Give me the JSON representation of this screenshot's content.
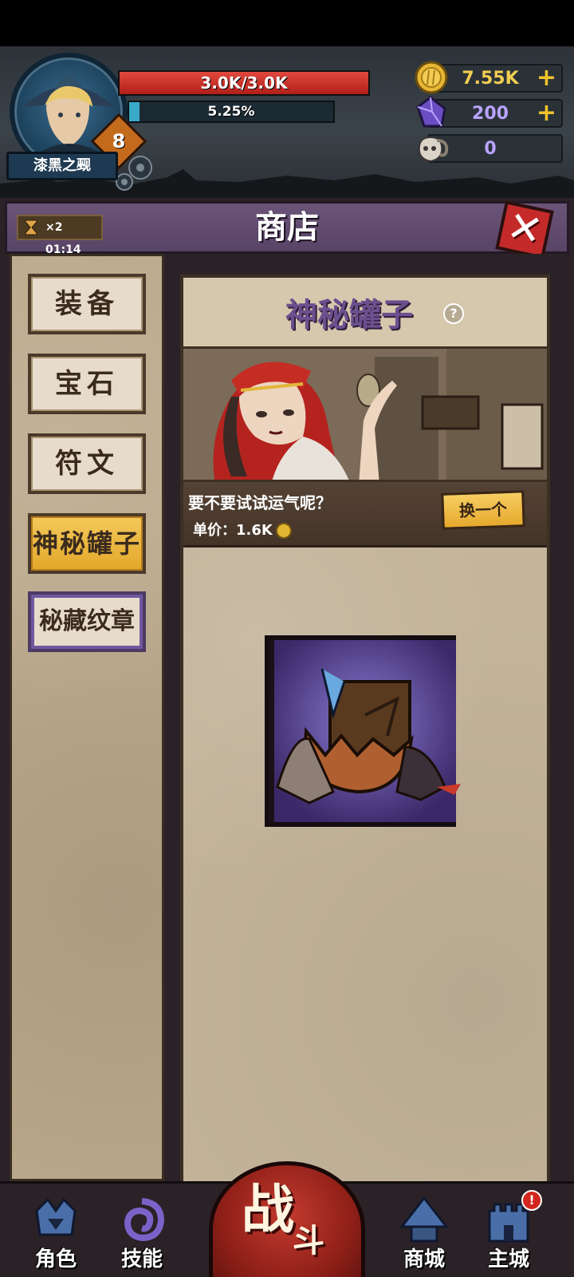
{
  "player": {
    "name": "漆黑之觋",
    "level": "8",
    "hp_text": "3.0K/3.0K",
    "hp_fraction": 1.0,
    "xp_text": "5.25%",
    "xp_fraction": 0.0525
  },
  "resources": {
    "gold": "7.55K",
    "gems": "200",
    "skulls": "0"
  },
  "shop": {
    "title": "商店",
    "timer": {
      "multiplier": "×2",
      "time": "01:14"
    },
    "tabs": [
      {
        "label": "装备",
        "active": false
      },
      {
        "label": "宝石",
        "active": false
      },
      {
        "label": "符文",
        "active": false
      },
      {
        "label": "神秘罐子",
        "active": true
      },
      {
        "label": "秘藏纹章",
        "active": false
      }
    ],
    "card": {
      "title": "神秘罐子",
      "flavor": "要不要试试运气呢？",
      "price_label": "单价：",
      "price_value": "1.6K",
      "swap_label": "换一个"
    }
  },
  "nav": {
    "character": "角色",
    "skills": "技能",
    "battle_main": "战",
    "battle_sub": "斗",
    "market": "商城",
    "city": "主城",
    "city_badge": "!"
  },
  "colors": {
    "accent_gold": "#e3a72b",
    "purple_title": "#6c4f8e",
    "hp_red": "#c42a22",
    "xp_blue": "#38a9c9"
  }
}
